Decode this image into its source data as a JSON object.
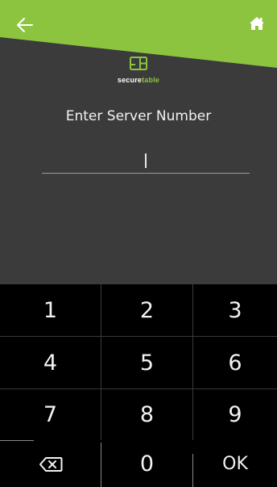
{
  "header": {
    "back_icon": "arrow-left-icon",
    "home_icon": "home-icon",
    "accent_color": "#8cc43f"
  },
  "logo": {
    "icon": "securetable-logo-icon",
    "text_part1": "secure",
    "text_part2": "table"
  },
  "prompt": {
    "title": "Enter Server Number"
  },
  "input": {
    "value": ""
  },
  "keypad": {
    "keys": [
      {
        "label": "1"
      },
      {
        "label": "2"
      },
      {
        "label": "3"
      },
      {
        "label": "4"
      },
      {
        "label": "5"
      },
      {
        "label": "6"
      },
      {
        "label": "7"
      },
      {
        "label": "8"
      },
      {
        "label": "9"
      },
      {
        "label": ""
      },
      {
        "label": "0"
      },
      {
        "label": "OK"
      }
    ],
    "backspace_icon": "backspace-icon"
  }
}
